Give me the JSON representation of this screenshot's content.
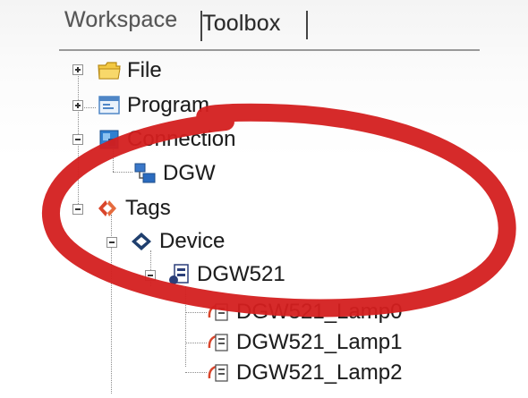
{
  "tabs": {
    "workspace": "Workspace",
    "toolbox": "Toolbox"
  },
  "tree": {
    "file": "File",
    "program": "Program",
    "connection": "Connection",
    "dgw": "DGW",
    "tags": "Tags",
    "device": "Device",
    "dgw521": "DGW521",
    "lamp0": "DGW521_Lamp0",
    "lamp1": "DGW521_Lamp1",
    "lamp2": "DGW521_Lamp2"
  },
  "colors": {
    "highlight": "#d41f1f",
    "folder": "#f3c842",
    "program_icon": "#4f86c6",
    "connection_icon": "#2f7fd0",
    "tags_icon": "#d9452b"
  }
}
